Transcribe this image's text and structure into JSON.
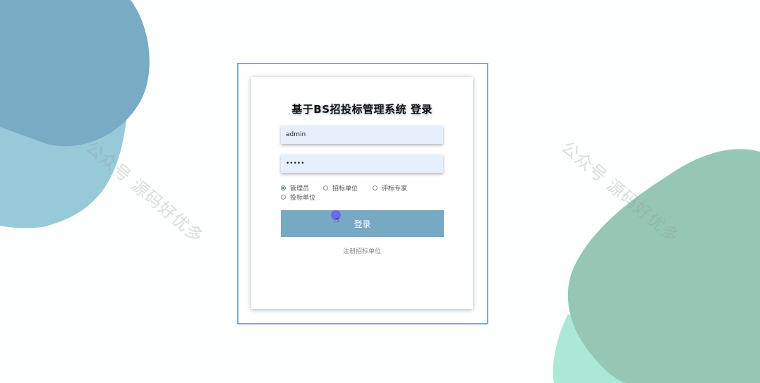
{
  "page": {
    "title": "基于BS招投标管理系统 登录"
  },
  "form": {
    "username_value": "admin",
    "password_value": "•••••",
    "login_label": "登录",
    "register_label": "注册招标单位"
  },
  "roles": [
    {
      "label": "管理员",
      "checked": true
    },
    {
      "label": "招标单位",
      "checked": false
    },
    {
      "label": "评标专家",
      "checked": false
    },
    {
      "label": "投标单位",
      "checked": false
    }
  ],
  "watermark": {
    "text": "公众号 源码好优多"
  },
  "colors": {
    "accent": "#78a9c4",
    "frame_border": "#7aaec4",
    "input_bg": "#e8effc",
    "blob_blue": "#78abc4",
    "blob_light_blue": "#98c9d9",
    "blob_green": "#96c7b5",
    "blob_mint": "#ace8d6"
  }
}
